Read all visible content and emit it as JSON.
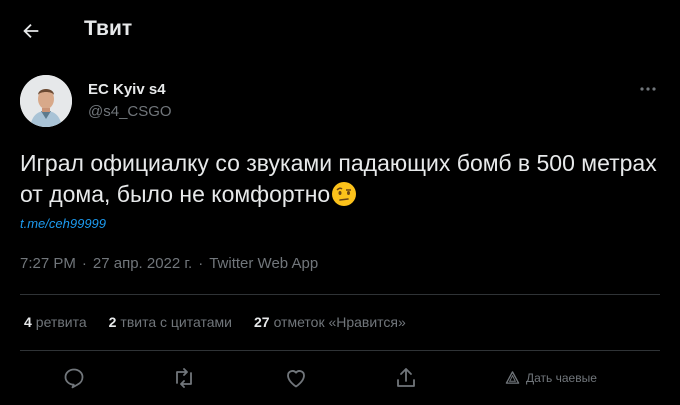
{
  "header": {
    "title": "Твит",
    "back_icon": "arrow-left-icon"
  },
  "author": {
    "name": "EC Kyiv s4",
    "handle": "@s4_CSGO",
    "avatar_icon": "user-avatar",
    "more_icon": "more-icon"
  },
  "tweet": {
    "text": "Играл официалку со звуками падающих бомб в 500 метрах от дома, было не комфортно",
    "emoji": "raised-eyebrow-emoji",
    "link": "t.me/ceh99999",
    "time": "7:27 PM",
    "date": "27 апр. 2022 г.",
    "separator": "·",
    "app": "Twitter Web App"
  },
  "stats": {
    "retweets_count": "4",
    "retweets_label": "ретвита",
    "quotes_count": "2",
    "quotes_label": "твита с цитатами",
    "likes_count": "27",
    "likes_label": "отметок «Нравится»"
  },
  "actions": {
    "reply_icon": "reply-icon",
    "retweet_icon": "retweet-icon",
    "like_icon": "heart-icon",
    "share_icon": "share-icon",
    "analytics_label": "Дать чаевые",
    "analytics_icon": "tip-icon"
  },
  "colors": {
    "background": "#000000",
    "text": "#e7e9ea",
    "secondary": "#71767b",
    "link": "#1d9bf0",
    "divider": "#2f3336"
  }
}
